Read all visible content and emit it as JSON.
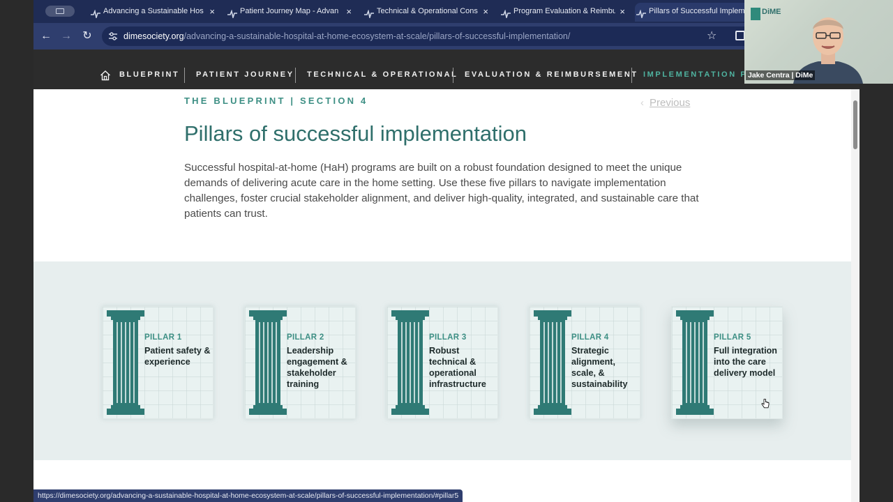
{
  "browser": {
    "tabs": [
      {
        "title": "Advancing a Sustainable Hos",
        "active": false
      },
      {
        "title": "Patient Journey Map - Advan",
        "active": false
      },
      {
        "title": "Technical & Operational Cons",
        "active": false
      },
      {
        "title": "Program Evaluation & Reimbu",
        "active": false
      },
      {
        "title": "Pillars of Successful Impleme",
        "active": true
      }
    ],
    "tab_close": "×",
    "url_host": "dimesociety.org",
    "url_path": "/advancing-a-sustainable-hospital-at-home-ecosystem-at-scale/pillars-of-successful-implementation/",
    "status_url": "https://dimesociety.org/advancing-a-sustainable-hospital-at-home-ecosystem-at-scale/pillars-of-successful-implementation/#pillar5"
  },
  "site_nav": {
    "items": [
      "BLUEPRINT",
      "PATIENT JOURNEY",
      "TECHNICAL & OPERATIONAL",
      "EVALUATION & REIMBURSEMENT",
      "IMPLEMENTATION PIL"
    ]
  },
  "page": {
    "eyebrow": "THE BLUEPRINT | SECTION 4",
    "previous": "Previous",
    "title": "Pillars of successful implementation",
    "intro": "Successful hospital-at-home (HaH) programs are built on a robust foundation designed to meet the unique demands of delivering acute care in the home setting. Use these five pillars to navigate implementation challenges, foster crucial stakeholder alignment, and deliver high-quality, integrated, and sustainable care that patients can trust."
  },
  "pillars": [
    {
      "num": "PILLAR 1",
      "name": "Patient safety & experience"
    },
    {
      "num": "PILLAR 2",
      "name": "Leadership engagement & stakeholder training"
    },
    {
      "num": "PILLAR 3",
      "name": "Robust technical & operational infrastructure"
    },
    {
      "num": "PILLAR 4",
      "name": "Strategic alignment, scale, & sustainability"
    },
    {
      "num": "PILLAR 5",
      "name": "Full integration into the care delivery model"
    }
  ],
  "webcam": {
    "name": "Jake Centra | DiMe",
    "logo": "DiME"
  },
  "colors": {
    "accent": "#3d8f84",
    "pillar": "#2f7a75",
    "title": "#2f6f6b",
    "nav_bg": "#2c2c2c",
    "chrome": "#2f3e6e"
  }
}
